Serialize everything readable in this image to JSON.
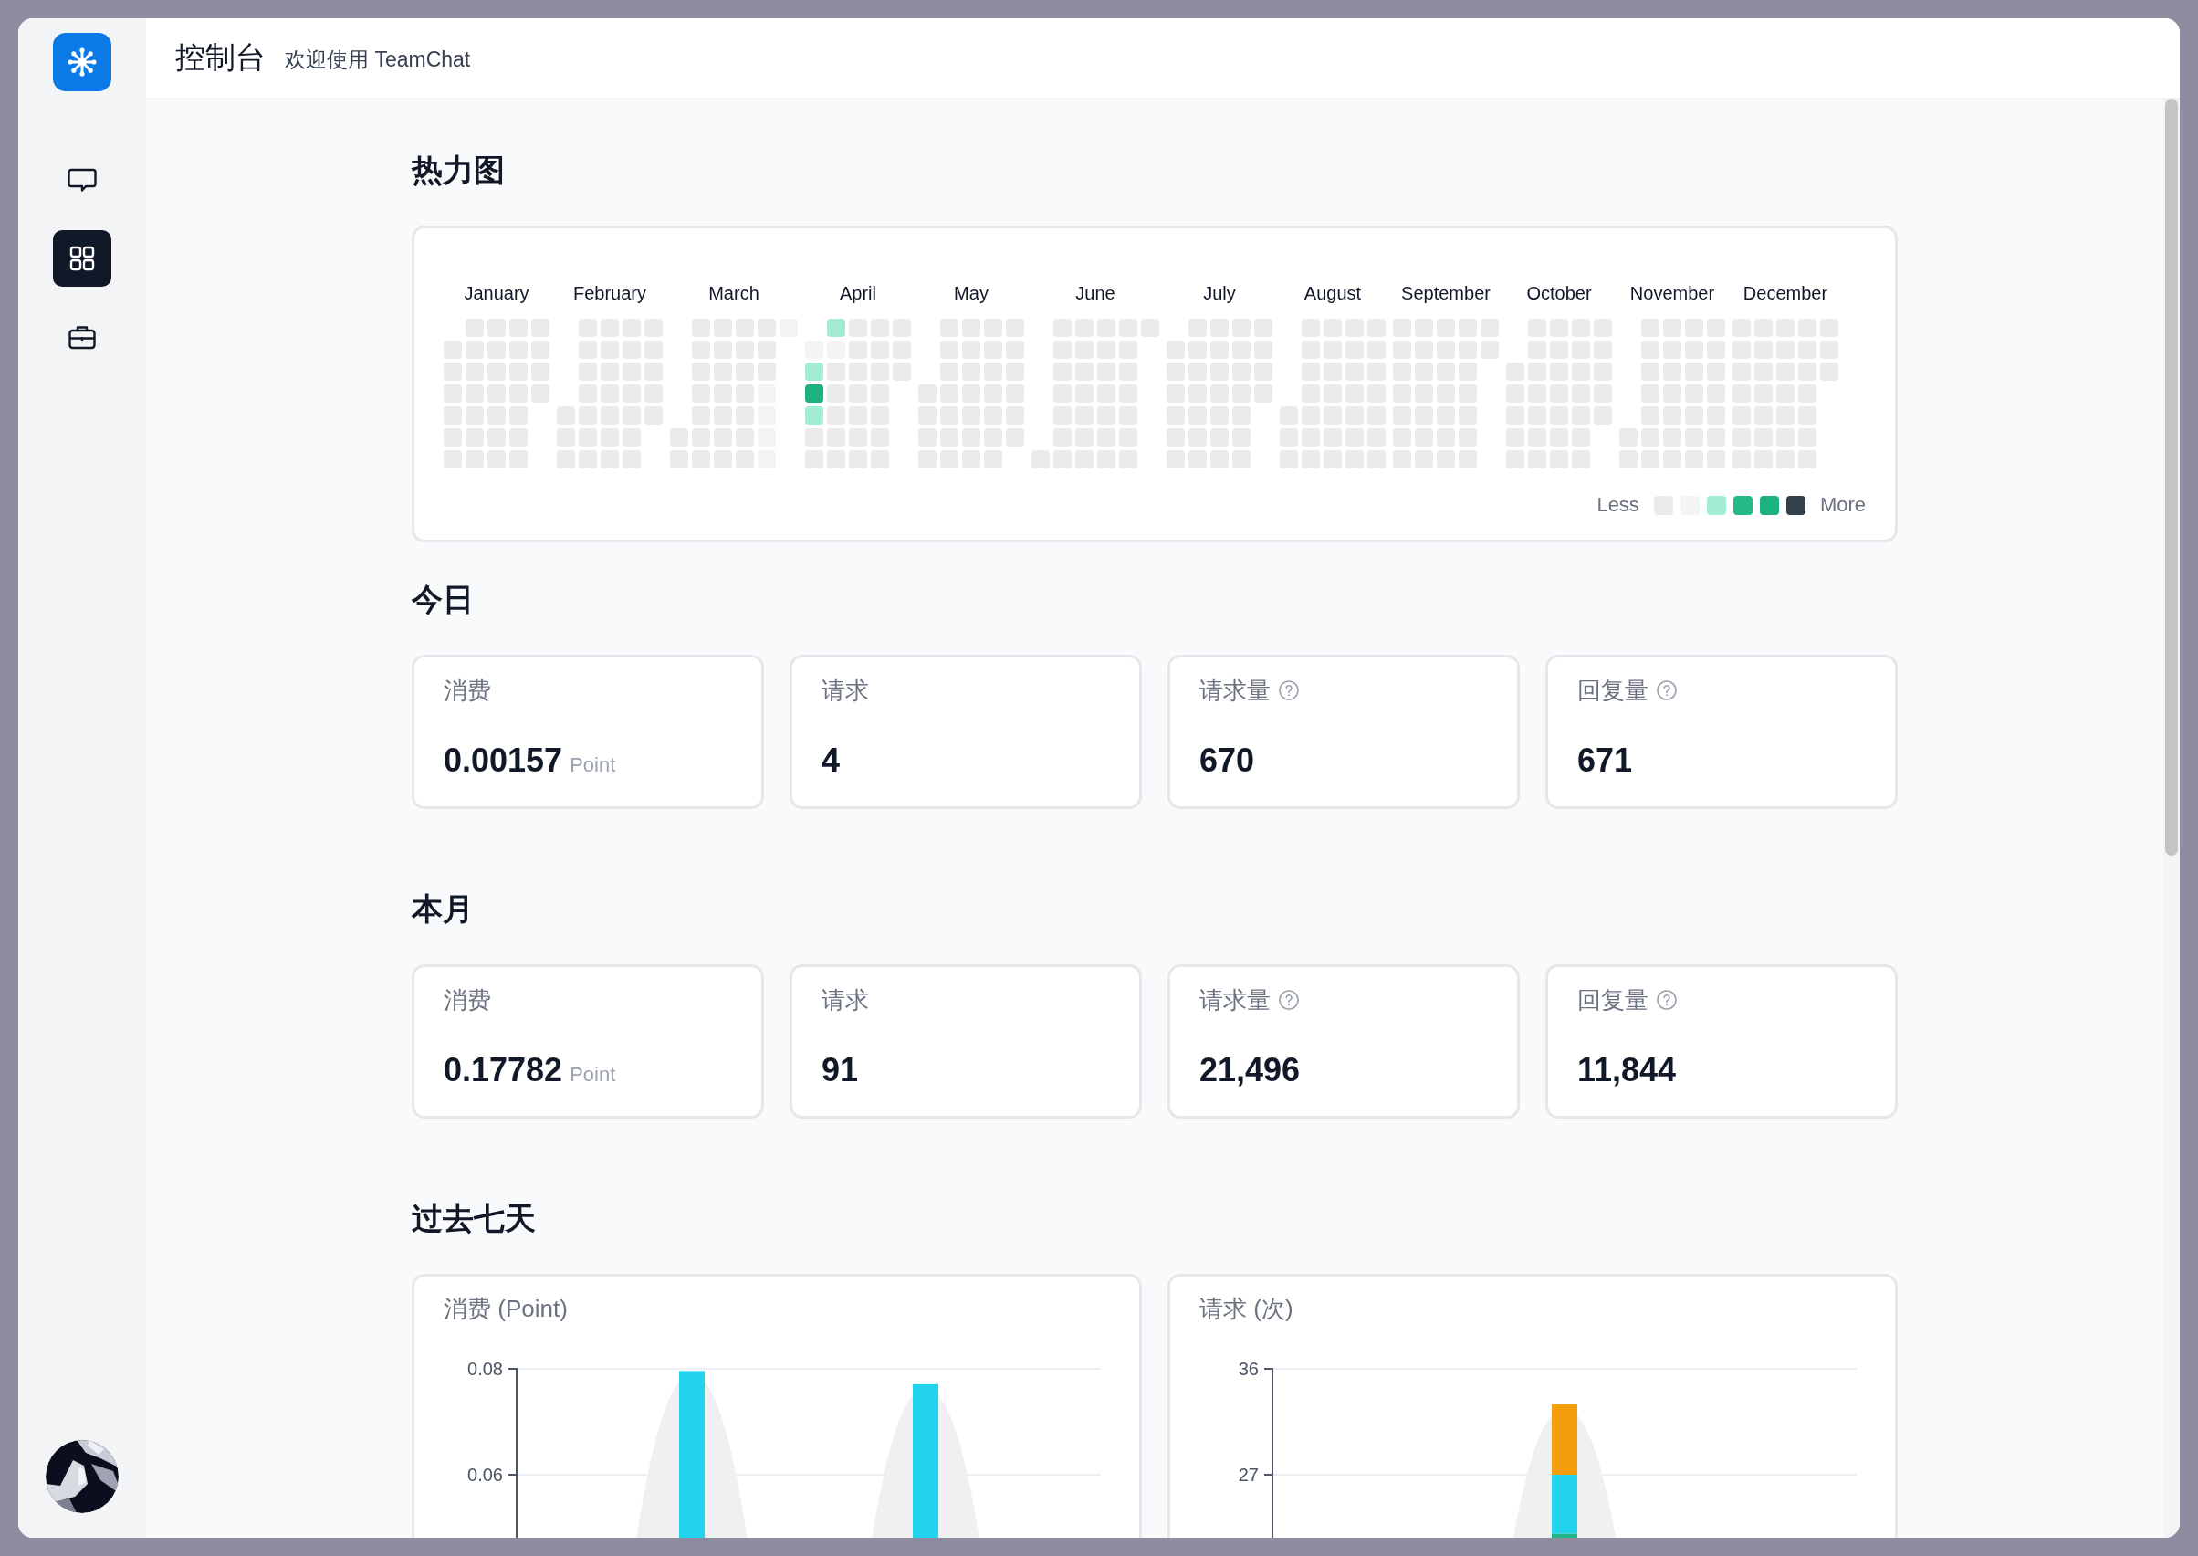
{
  "sidebar": {
    "nav": [
      {
        "selected": false
      },
      {
        "selected": true
      },
      {
        "selected": false
      }
    ]
  },
  "header": {
    "title": "控制台",
    "subtitle": "欢迎使用 TeamChat"
  },
  "heatmap": {
    "title": "热力图",
    "months": [
      {
        "label": "January",
        "weeks": [
          {
            "days": [
              {
                "color": "#ebebeb"
              },
              {
                "color": "#ebebeb"
              },
              {
                "color": "#ebebeb"
              },
              {
                "color": "#ebebeb"
              },
              {
                "color": "#ebebeb"
              },
              {
                "color": "#ebebeb"
              }
            ]
          },
          {
            "days": [
              {
                "color": "#ebebeb"
              },
              {
                "color": "#ebebeb"
              },
              {
                "color": "#ebebeb"
              },
              {
                "color": "#ebebeb"
              },
              {
                "color": "#ebebeb"
              },
              {
                "color": "#ebebeb"
              },
              {
                "color": "#ebebeb"
              }
            ]
          },
          {
            "days": [
              {
                "color": "#ebebeb"
              },
              {
                "color": "#ebebeb"
              },
              {
                "color": "#ebebeb"
              },
              {
                "color": "#ebebeb"
              },
              {
                "color": "#ebebeb"
              },
              {
                "color": "#ebebeb"
              },
              {
                "color": "#ebebeb"
              }
            ]
          },
          {
            "days": [
              {
                "color": "#ebebeb"
              },
              {
                "color": "#ebebeb"
              },
              {
                "color": "#ebebeb"
              },
              {
                "color": "#ebebeb"
              },
              {
                "color": "#ebebeb"
              },
              {
                "color": "#ebebeb"
              },
              {
                "color": "#ebebeb"
              }
            ]
          },
          {
            "days": [
              {
                "color": "#ebebeb"
              },
              {
                "color": "#ebebeb"
              },
              {
                "color": "#ebebeb"
              },
              {
                "color": "#ebebeb"
              }
            ]
          }
        ]
      },
      {
        "label": "February",
        "weeks": [
          {
            "days": [
              {
                "color": "#ebebeb"
              },
              {
                "color": "#ebebeb"
              },
              {
                "color": "#ebebeb"
              }
            ]
          },
          {
            "days": [
              {
                "color": "#ebebeb"
              },
              {
                "color": "#ebebeb"
              },
              {
                "color": "#ebebeb"
              },
              {
                "color": "#ebebeb"
              },
              {
                "color": "#ebebeb"
              },
              {
                "color": "#ebebeb"
              },
              {
                "color": "#ebebeb"
              }
            ]
          },
          {
            "days": [
              {
                "color": "#ebebeb"
              },
              {
                "color": "#ebebeb"
              },
              {
                "color": "#ebebeb"
              },
              {
                "color": "#ebebeb"
              },
              {
                "color": "#ebebeb"
              },
              {
                "color": "#ebebeb"
              },
              {
                "color": "#ebebeb"
              }
            ]
          },
          {
            "days": [
              {
                "color": "#ebebeb"
              },
              {
                "color": "#ebebeb"
              },
              {
                "color": "#ebebeb"
              },
              {
                "color": "#ebebeb"
              },
              {
                "color": "#ebebeb"
              },
              {
                "color": "#ebebeb"
              },
              {
                "color": "#ebebeb"
              }
            ]
          },
          {
            "days": [
              {
                "color": "#ebebeb"
              },
              {
                "color": "#ebebeb"
              },
              {
                "color": "#ebebeb"
              },
              {
                "color": "#ebebeb"
              },
              {
                "color": "#ebebeb"
              }
            ]
          }
        ]
      },
      {
        "label": "March",
        "weeks": [
          {
            "days": [
              {
                "color": "#ebebeb"
              },
              {
                "color": "#ebebeb"
              }
            ]
          },
          {
            "days": [
              {
                "color": "#ebebeb"
              },
              {
                "color": "#ebebeb"
              },
              {
                "color": "#ebebeb"
              },
              {
                "color": "#ebebeb"
              },
              {
                "color": "#ebebeb"
              },
              {
                "color": "#ebebeb"
              },
              {
                "color": "#ebebeb"
              }
            ]
          },
          {
            "days": [
              {
                "color": "#ebebeb"
              },
              {
                "color": "#ebebeb"
              },
              {
                "color": "#ebebeb"
              },
              {
                "color": "#ebebeb"
              },
              {
                "color": "#ebebeb"
              },
              {
                "color": "#ebebeb"
              },
              {
                "color": "#ebebeb"
              }
            ]
          },
          {
            "days": [
              {
                "color": "#ebebeb"
              },
              {
                "color": "#ebebeb"
              },
              {
                "color": "#ebebeb"
              },
              {
                "color": "#ebebeb"
              },
              {
                "color": "#ebebeb"
              },
              {
                "color": "#ebebeb"
              },
              {
                "color": "#ebebeb"
              }
            ]
          },
          {
            "days": [
              {
                "color": "#ebebeb"
              },
              {
                "color": "#ebebeb"
              },
              {
                "color": "#ebebeb"
              },
              {
                "color": "#f3f4f6"
              },
              {
                "color": "#f3f4f6"
              },
              {
                "color": "#f3f4f6"
              },
              {
                "color": "#f3f4f6"
              }
            ]
          },
          {
            "days": [
              {
                "color": "#f3f4f6"
              }
            ]
          }
        ]
      },
      {
        "label": "April",
        "weeks": [
          {
            "days": [
              {
                "color": "#f3f4f6"
              },
              {
                "color": "#a4edd5"
              },
              {
                "color": "#1db180"
              },
              {
                "color": "#a4edd5"
              },
              {
                "color": "#ebebeb"
              },
              {
                "color": "#ebebeb"
              }
            ]
          },
          {
            "days": [
              {
                "color": "#a4edd5"
              },
              {
                "color": "#f3f4f6"
              },
              {
                "color": "#ebebeb"
              },
              {
                "color": "#ebebeb"
              },
              {
                "color": "#ebebeb"
              },
              {
                "color": "#ebebeb"
              },
              {
                "color": "#ebebeb"
              }
            ]
          },
          {
            "days": [
              {
                "color": "#ebebeb"
              },
              {
                "color": "#ebebeb"
              },
              {
                "color": "#ebebeb"
              },
              {
                "color": "#ebebeb"
              },
              {
                "color": "#ebebeb"
              },
              {
                "color": "#ebebeb"
              },
              {
                "color": "#ebebeb"
              }
            ]
          },
          {
            "days": [
              {
                "color": "#ebebeb"
              },
              {
                "color": "#ebebeb"
              },
              {
                "color": "#ebebeb"
              },
              {
                "color": "#ebebeb"
              },
              {
                "color": "#ebebeb"
              },
              {
                "color": "#ebebeb"
              },
              {
                "color": "#ebebeb"
              }
            ]
          },
          {
            "days": [
              {
                "color": "#ebebeb"
              },
              {
                "color": "#ebebeb"
              },
              {
                "color": "#ebebeb"
              }
            ]
          }
        ]
      },
      {
        "label": "May",
        "weeks": [
          {
            "days": [
              {
                "color": "#ebebeb"
              },
              {
                "color": "#ebebeb"
              },
              {
                "color": "#ebebeb"
              },
              {
                "color": "#ebebeb"
              }
            ]
          },
          {
            "days": [
              {
                "color": "#ebebeb"
              },
              {
                "color": "#ebebeb"
              },
              {
                "color": "#ebebeb"
              },
              {
                "color": "#ebebeb"
              },
              {
                "color": "#ebebeb"
              },
              {
                "color": "#ebebeb"
              },
              {
                "color": "#ebebeb"
              }
            ]
          },
          {
            "days": [
              {
                "color": "#ebebeb"
              },
              {
                "color": "#ebebeb"
              },
              {
                "color": "#ebebeb"
              },
              {
                "color": "#ebebeb"
              },
              {
                "color": "#ebebeb"
              },
              {
                "color": "#ebebeb"
              },
              {
                "color": "#ebebeb"
              }
            ]
          },
          {
            "days": [
              {
                "color": "#ebebeb"
              },
              {
                "color": "#ebebeb"
              },
              {
                "color": "#ebebeb"
              },
              {
                "color": "#ebebeb"
              },
              {
                "color": "#ebebeb"
              },
              {
                "color": "#ebebeb"
              },
              {
                "color": "#ebebeb"
              }
            ]
          },
          {
            "days": [
              {
                "color": "#ebebeb"
              },
              {
                "color": "#ebebeb"
              },
              {
                "color": "#ebebeb"
              },
              {
                "color": "#ebebeb"
              },
              {
                "color": "#ebebeb"
              },
              {
                "color": "#ebebeb"
              }
            ]
          }
        ]
      },
      {
        "label": "June",
        "weeks": [
          {
            "days": [
              {
                "color": "#ebebeb"
              }
            ]
          },
          {
            "days": [
              {
                "color": "#ebebeb"
              },
              {
                "color": "#ebebeb"
              },
              {
                "color": "#ebebeb"
              },
              {
                "color": "#ebebeb"
              },
              {
                "color": "#ebebeb"
              },
              {
                "color": "#ebebeb"
              },
              {
                "color": "#ebebeb"
              }
            ]
          },
          {
            "days": [
              {
                "color": "#ebebeb"
              },
              {
                "color": "#ebebeb"
              },
              {
                "color": "#ebebeb"
              },
              {
                "color": "#ebebeb"
              },
              {
                "color": "#ebebeb"
              },
              {
                "color": "#ebebeb"
              },
              {
                "color": "#ebebeb"
              }
            ]
          },
          {
            "days": [
              {
                "color": "#ebebeb"
              },
              {
                "color": "#ebebeb"
              },
              {
                "color": "#ebebeb"
              },
              {
                "color": "#ebebeb"
              },
              {
                "color": "#ebebeb"
              },
              {
                "color": "#ebebeb"
              },
              {
                "color": "#ebebeb"
              }
            ]
          },
          {
            "days": [
              {
                "color": "#ebebeb"
              },
              {
                "color": "#ebebeb"
              },
              {
                "color": "#ebebeb"
              },
              {
                "color": "#ebebeb"
              },
              {
                "color": "#ebebeb"
              },
              {
                "color": "#ebebeb"
              },
              {
                "color": "#ebebeb"
              }
            ]
          },
          {
            "days": [
              {
                "color": "#ebebeb"
              }
            ]
          }
        ]
      },
      {
        "label": "July",
        "weeks": [
          {
            "days": [
              {
                "color": "#ebebeb"
              },
              {
                "color": "#ebebeb"
              },
              {
                "color": "#ebebeb"
              },
              {
                "color": "#ebebeb"
              },
              {
                "color": "#ebebeb"
              },
              {
                "color": "#ebebeb"
              }
            ]
          },
          {
            "days": [
              {
                "color": "#ebebeb"
              },
              {
                "color": "#ebebeb"
              },
              {
                "color": "#ebebeb"
              },
              {
                "color": "#ebebeb"
              },
              {
                "color": "#ebebeb"
              },
              {
                "color": "#ebebeb"
              },
              {
                "color": "#ebebeb"
              }
            ]
          },
          {
            "days": [
              {
                "color": "#ebebeb"
              },
              {
                "color": "#ebebeb"
              },
              {
                "color": "#ebebeb"
              },
              {
                "color": "#ebebeb"
              },
              {
                "color": "#ebebeb"
              },
              {
                "color": "#ebebeb"
              },
              {
                "color": "#ebebeb"
              }
            ]
          },
          {
            "days": [
              {
                "color": "#ebebeb"
              },
              {
                "color": "#ebebeb"
              },
              {
                "color": "#ebebeb"
              },
              {
                "color": "#ebebeb"
              },
              {
                "color": "#ebebeb"
              },
              {
                "color": "#ebebeb"
              },
              {
                "color": "#ebebeb"
              }
            ]
          },
          {
            "days": [
              {
                "color": "#ebebeb"
              },
              {
                "color": "#ebebeb"
              },
              {
                "color": "#ebebeb"
              },
              {
                "color": "#ebebeb"
              }
            ]
          }
        ]
      },
      {
        "label": "August",
        "weeks": [
          {
            "days": [
              {
                "color": "#ebebeb"
              },
              {
                "color": "#ebebeb"
              },
              {
                "color": "#ebebeb"
              }
            ]
          },
          {
            "days": [
              {
                "color": "#ebebeb"
              },
              {
                "color": "#ebebeb"
              },
              {
                "color": "#ebebeb"
              },
              {
                "color": "#ebebeb"
              },
              {
                "color": "#ebebeb"
              },
              {
                "color": "#ebebeb"
              },
              {
                "color": "#ebebeb"
              }
            ]
          },
          {
            "days": [
              {
                "color": "#ebebeb"
              },
              {
                "color": "#ebebeb"
              },
              {
                "color": "#ebebeb"
              },
              {
                "color": "#ebebeb"
              },
              {
                "color": "#ebebeb"
              },
              {
                "color": "#ebebeb"
              },
              {
                "color": "#ebebeb"
              }
            ]
          },
          {
            "days": [
              {
                "color": "#ebebeb"
              },
              {
                "color": "#ebebeb"
              },
              {
                "color": "#ebebeb"
              },
              {
                "color": "#ebebeb"
              },
              {
                "color": "#ebebeb"
              },
              {
                "color": "#ebebeb"
              },
              {
                "color": "#ebebeb"
              }
            ]
          },
          {
            "days": [
              {
                "color": "#ebebeb"
              },
              {
                "color": "#ebebeb"
              },
              {
                "color": "#ebebeb"
              },
              {
                "color": "#ebebeb"
              },
              {
                "color": "#ebebeb"
              },
              {
                "color": "#ebebeb"
              },
              {
                "color": "#ebebeb"
              }
            ]
          }
        ]
      },
      {
        "label": "September",
        "weeks": [
          {
            "days": [
              {
                "color": "#ebebeb"
              },
              {
                "color": "#ebebeb"
              },
              {
                "color": "#ebebeb"
              },
              {
                "color": "#ebebeb"
              },
              {
                "color": "#ebebeb"
              },
              {
                "color": "#ebebeb"
              },
              {
                "color": "#ebebeb"
              }
            ]
          },
          {
            "days": [
              {
                "color": "#ebebeb"
              },
              {
                "color": "#ebebeb"
              },
              {
                "color": "#ebebeb"
              },
              {
                "color": "#ebebeb"
              },
              {
                "color": "#ebebeb"
              },
              {
                "color": "#ebebeb"
              },
              {
                "color": "#ebebeb"
              }
            ]
          },
          {
            "days": [
              {
                "color": "#ebebeb"
              },
              {
                "color": "#ebebeb"
              },
              {
                "color": "#ebebeb"
              },
              {
                "color": "#ebebeb"
              },
              {
                "color": "#ebebeb"
              },
              {
                "color": "#ebebeb"
              },
              {
                "color": "#ebebeb"
              }
            ]
          },
          {
            "days": [
              {
                "color": "#ebebeb"
              },
              {
                "color": "#ebebeb"
              },
              {
                "color": "#ebebeb"
              },
              {
                "color": "#ebebeb"
              },
              {
                "color": "#ebebeb"
              },
              {
                "color": "#ebebeb"
              },
              {
                "color": "#ebebeb"
              }
            ]
          },
          {
            "days": [
              {
                "color": "#ebebeb"
              },
              {
                "color": "#ebebeb"
              }
            ]
          }
        ]
      },
      {
        "label": "October",
        "weeks": [
          {
            "days": [
              {
                "color": "#ebebeb"
              },
              {
                "color": "#ebebeb"
              },
              {
                "color": "#ebebeb"
              },
              {
                "color": "#ebebeb"
              },
              {
                "color": "#ebebeb"
              }
            ]
          },
          {
            "days": [
              {
                "color": "#ebebeb"
              },
              {
                "color": "#ebebeb"
              },
              {
                "color": "#ebebeb"
              },
              {
                "color": "#ebebeb"
              },
              {
                "color": "#ebebeb"
              },
              {
                "color": "#ebebeb"
              },
              {
                "color": "#ebebeb"
              }
            ]
          },
          {
            "days": [
              {
                "color": "#ebebeb"
              },
              {
                "color": "#ebebeb"
              },
              {
                "color": "#ebebeb"
              },
              {
                "color": "#ebebeb"
              },
              {
                "color": "#ebebeb"
              },
              {
                "color": "#ebebeb"
              },
              {
                "color": "#ebebeb"
              }
            ]
          },
          {
            "days": [
              {
                "color": "#ebebeb"
              },
              {
                "color": "#ebebeb"
              },
              {
                "color": "#ebebeb"
              },
              {
                "color": "#ebebeb"
              },
              {
                "color": "#ebebeb"
              },
              {
                "color": "#ebebeb"
              },
              {
                "color": "#ebebeb"
              }
            ]
          },
          {
            "days": [
              {
                "color": "#ebebeb"
              },
              {
                "color": "#ebebeb"
              },
              {
                "color": "#ebebeb"
              },
              {
                "color": "#ebebeb"
              },
              {
                "color": "#ebebeb"
              }
            ]
          }
        ]
      },
      {
        "label": "November",
        "weeks": [
          {
            "days": [
              {
                "color": "#ebebeb"
              },
              {
                "color": "#ebebeb"
              }
            ]
          },
          {
            "days": [
              {
                "color": "#ebebeb"
              },
              {
                "color": "#ebebeb"
              },
              {
                "color": "#ebebeb"
              },
              {
                "color": "#ebebeb"
              },
              {
                "color": "#ebebeb"
              },
              {
                "color": "#ebebeb"
              },
              {
                "color": "#ebebeb"
              }
            ]
          },
          {
            "days": [
              {
                "color": "#ebebeb"
              },
              {
                "color": "#ebebeb"
              },
              {
                "color": "#ebebeb"
              },
              {
                "color": "#ebebeb"
              },
              {
                "color": "#ebebeb"
              },
              {
                "color": "#ebebeb"
              },
              {
                "color": "#ebebeb"
              }
            ]
          },
          {
            "days": [
              {
                "color": "#ebebeb"
              },
              {
                "color": "#ebebeb"
              },
              {
                "color": "#ebebeb"
              },
              {
                "color": "#ebebeb"
              },
              {
                "color": "#ebebeb"
              },
              {
                "color": "#ebebeb"
              },
              {
                "color": "#ebebeb"
              }
            ]
          },
          {
            "days": [
              {
                "color": "#ebebeb"
              },
              {
                "color": "#ebebeb"
              },
              {
                "color": "#ebebeb"
              },
              {
                "color": "#ebebeb"
              },
              {
                "color": "#ebebeb"
              },
              {
                "color": "#ebebeb"
              },
              {
                "color": "#ebebeb"
              }
            ]
          }
        ]
      },
      {
        "label": "December",
        "weeks": [
          {
            "days": [
              {
                "color": "#ebebeb"
              },
              {
                "color": "#ebebeb"
              },
              {
                "color": "#ebebeb"
              },
              {
                "color": "#ebebeb"
              },
              {
                "color": "#ebebeb"
              },
              {
                "color": "#ebebeb"
              },
              {
                "color": "#ebebeb"
              }
            ]
          },
          {
            "days": [
              {
                "color": "#ebebeb"
              },
              {
                "color": "#ebebeb"
              },
              {
                "color": "#ebebeb"
              },
              {
                "color": "#ebebeb"
              },
              {
                "color": "#ebebeb"
              },
              {
                "color": "#ebebeb"
              },
              {
                "color": "#ebebeb"
              }
            ]
          },
          {
            "days": [
              {
                "color": "#ebebeb"
              },
              {
                "color": "#ebebeb"
              },
              {
                "color": "#ebebeb"
              },
              {
                "color": "#ebebeb"
              },
              {
                "color": "#ebebeb"
              },
              {
                "color": "#ebebeb"
              },
              {
                "color": "#ebebeb"
              }
            ]
          },
          {
            "days": [
              {
                "color": "#ebebeb"
              },
              {
                "color": "#ebebeb"
              },
              {
                "color": "#ebebeb"
              },
              {
                "color": "#ebebeb"
              },
              {
                "color": "#ebebeb"
              },
              {
                "color": "#ebebeb"
              },
              {
                "color": "#ebebeb"
              }
            ]
          },
          {
            "days": [
              {
                "color": "#ebebeb"
              },
              {
                "color": "#ebebeb"
              },
              {
                "color": "#ebebeb"
              }
            ]
          }
        ]
      }
    ],
    "legend": {
      "less": "Less",
      "more": "More",
      "swatches": [
        {
          "color": "#ebebeb"
        },
        {
          "color": "#f3f4f6"
        },
        {
          "color": "#a4edd5"
        },
        {
          "color": "#25b98a"
        },
        {
          "color": "#1db180"
        },
        {
          "color": "#334049"
        }
      ]
    }
  },
  "today": {
    "title": "今日",
    "stats": [
      {
        "label": "消费",
        "value": "0.00157",
        "unit": "Point",
        "help": false
      },
      {
        "label": "请求",
        "value": "4",
        "help": false
      },
      {
        "label": "请求量",
        "value": "670",
        "help": true
      },
      {
        "label": "回复量",
        "value": "671",
        "help": true
      }
    ]
  },
  "month": {
    "title": "本月",
    "stats": [
      {
        "label": "消费",
        "value": "0.17782",
        "unit": "Point",
        "help": false
      },
      {
        "label": "请求",
        "value": "91",
        "help": false
      },
      {
        "label": "请求量",
        "value": "21,496",
        "help": true
      },
      {
        "label": "回复量",
        "value": "11,844",
        "help": true
      }
    ]
  },
  "last_seven_days": {
    "title": "过去七天",
    "charts": [
      {
        "title": "消费 (Point)",
        "chart_data": {
          "type": "bar",
          "ylim": [
            0,
            0.08
          ],
          "yticks": [
            0.06,
            0.08
          ],
          "series": [
            {
              "color": "#22d3ee",
              "values": [
                null,
                0.0796,
                null,
                0.0771,
                null
              ]
            }
          ]
        }
      },
      {
        "title": "请求 (次)",
        "chart_data": {
          "type": "bar",
          "stacked": true,
          "ylim": [
            0,
            36
          ],
          "yticks": [
            27,
            36
          ],
          "series": [
            {
              "color": "#1fb386",
              "values": [
                null,
                null,
                22,
                null,
                null
              ]
            },
            {
              "color": "#22d3ee",
              "values": [
                null,
                null,
                5,
                null,
                null
              ]
            },
            {
              "color": "#f59e0b",
              "values": [
                null,
                null,
                6,
                null,
                null
              ]
            }
          ]
        }
      }
    ]
  }
}
